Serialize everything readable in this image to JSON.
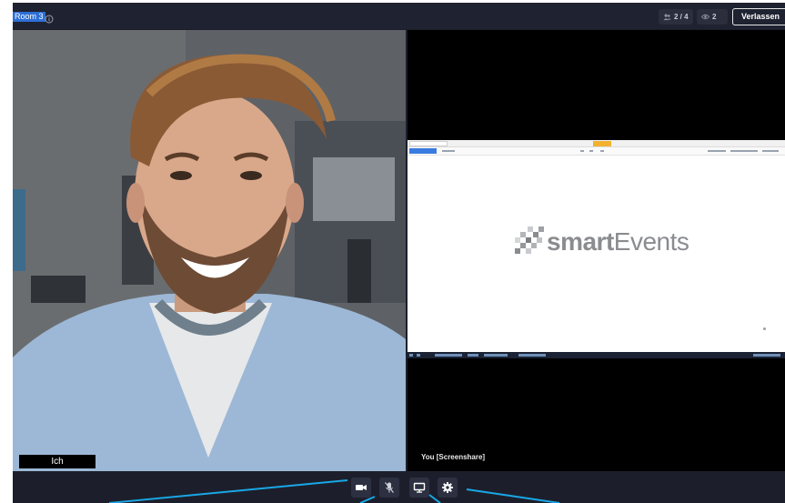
{
  "header": {
    "room_title": "Room 3",
    "participants": "2 / 4",
    "viewers": "2",
    "leave_label": "Verlassen"
  },
  "tiles": {
    "self": {
      "name": "Ich"
    },
    "share": {
      "name": "You [Screenshare]",
      "logo_bold": "smart",
      "logo_light": "Events"
    }
  },
  "controls": [
    {
      "name": "camera",
      "icon": "camera-icon"
    },
    {
      "name": "microphone",
      "icon": "mic-off-icon"
    },
    {
      "name": "screenshare",
      "icon": "monitor-icon"
    },
    {
      "name": "settings",
      "icon": "gear-icon"
    }
  ],
  "colors": {
    "app_background": "#1c1f2b",
    "room_highlight": "#2d6fd6",
    "callout_lines": "#19a7e6"
  }
}
